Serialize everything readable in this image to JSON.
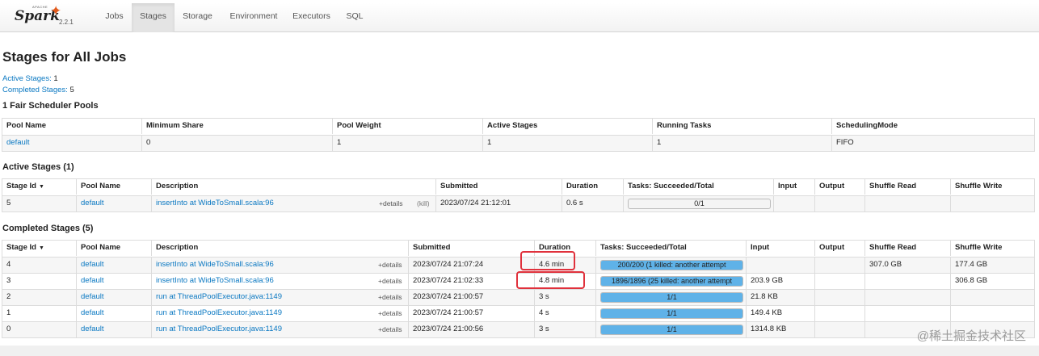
{
  "brand": {
    "apache": "APACHE",
    "name": "Spark",
    "version": "2.2.1"
  },
  "nav": [
    "Jobs",
    "Stages",
    "Storage",
    "Environment",
    "Executors",
    "SQL"
  ],
  "title": "Stages for All Jobs",
  "summary": {
    "active_label": "Active Stages:",
    "active_value": "1",
    "completed_label": "Completed Stages:",
    "completed_value": "5"
  },
  "pools": {
    "title": "1 Fair Scheduler Pools",
    "headers": [
      "Pool Name",
      "Minimum Share",
      "Pool Weight",
      "Active Stages",
      "Running Tasks",
      "SchedulingMode"
    ],
    "rows": [
      [
        "default",
        "0",
        "1",
        "1",
        "1",
        "FIFO"
      ]
    ]
  },
  "active": {
    "title": "Active Stages (1)",
    "headers": [
      "Stage Id",
      "Pool Name",
      "Description",
      "Submitted",
      "Duration",
      "Tasks: Succeeded/Total",
      "Input",
      "Output",
      "Shuffle Read",
      "Shuffle Write"
    ],
    "sort_arrow": "▼",
    "rows": [
      {
        "id": "5",
        "pool": "default",
        "desc": "insertInto at WideToSmall.scala:96",
        "details": "+details",
        "kill": "(kill)",
        "submitted": "2023/07/24 21:12:01",
        "duration": "0.6 s",
        "tasks": "0/1",
        "progress": 0,
        "input": "",
        "output": "",
        "shuffle_read": "",
        "shuffle_write": ""
      }
    ]
  },
  "completed": {
    "title": "Completed Stages (5)",
    "headers": [
      "Stage Id",
      "Pool Name",
      "Description",
      "Submitted",
      "Duration",
      "Tasks: Succeeded/Total",
      "Input",
      "Output",
      "Shuffle Read",
      "Shuffle Write"
    ],
    "sort_arrow": "▼",
    "rows": [
      {
        "id": "4",
        "pool": "default",
        "desc": "insertInto at WideToSmall.scala:96",
        "details": "+details",
        "submitted": "2023/07/24 21:07:24",
        "duration": "4.6 min",
        "tasks": "200/200 (1 killed: another attempt",
        "progress": 1,
        "input": "",
        "output": "",
        "shuffle_read": "307.0 GB",
        "shuffle_write": "177.4 GB"
      },
      {
        "id": "3",
        "pool": "default",
        "desc": "insertInto at WideToSmall.scala:96",
        "details": "+details",
        "submitted": "2023/07/24 21:02:33",
        "duration": "4.8 min",
        "tasks": "1896/1896 (25 killed: another attempt",
        "progress": 1,
        "input": "203.9 GB",
        "output": "",
        "shuffle_read": "",
        "shuffle_write": "306.8 GB"
      },
      {
        "id": "2",
        "pool": "default",
        "desc": "run at ThreadPoolExecutor.java:1149",
        "details": "+details",
        "submitted": "2023/07/24 21:00:57",
        "duration": "3 s",
        "tasks": "1/1",
        "progress": 1,
        "input": "21.8 KB",
        "output": "",
        "shuffle_read": "",
        "shuffle_write": ""
      },
      {
        "id": "1",
        "pool": "default",
        "desc": "run at ThreadPoolExecutor.java:1149",
        "details": "+details",
        "submitted": "2023/07/24 21:00:57",
        "duration": "4 s",
        "tasks": "1/1",
        "progress": 1,
        "input": "149.4 KB",
        "output": "",
        "shuffle_read": "",
        "shuffle_write": ""
      },
      {
        "id": "0",
        "pool": "default",
        "desc": "run at ThreadPoolExecutor.java:1149",
        "details": "+details",
        "submitted": "2023/07/24 21:00:56",
        "duration": "3 s",
        "tasks": "1/1",
        "progress": 1,
        "input": "1314.8 KB",
        "output": "",
        "shuffle_read": "",
        "shuffle_write": ""
      }
    ]
  },
  "watermark": "@稀土掘金技术社区",
  "colors": {
    "link": "#0a78c2",
    "progress_complete": "#5fb2e8",
    "progress_running": "#a9e2f7",
    "highlight": "#e0313c"
  }
}
